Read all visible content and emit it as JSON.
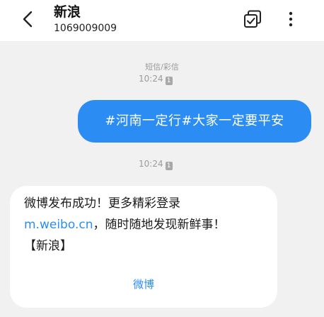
{
  "header": {
    "title": "新浪",
    "subtitle": "1069009009"
  },
  "thread": {
    "message_type": "短信/彩信",
    "time1": "10:24",
    "time2": "10:24",
    "sim_badge": "1",
    "outgoing_message": "#河南一定行#大家一定要平安",
    "incoming": {
      "line1": "微博发布成功！更多精彩登录",
      "link": "m.weibo.cn",
      "line2_rest": "，随时随地发现新鲜事！",
      "line3": "【新浪】",
      "action_label": "微博"
    }
  },
  "colors": {
    "accent": "#2b8df4",
    "background": "#f1f1f1",
    "bubble_incoming": "#ffffff"
  }
}
